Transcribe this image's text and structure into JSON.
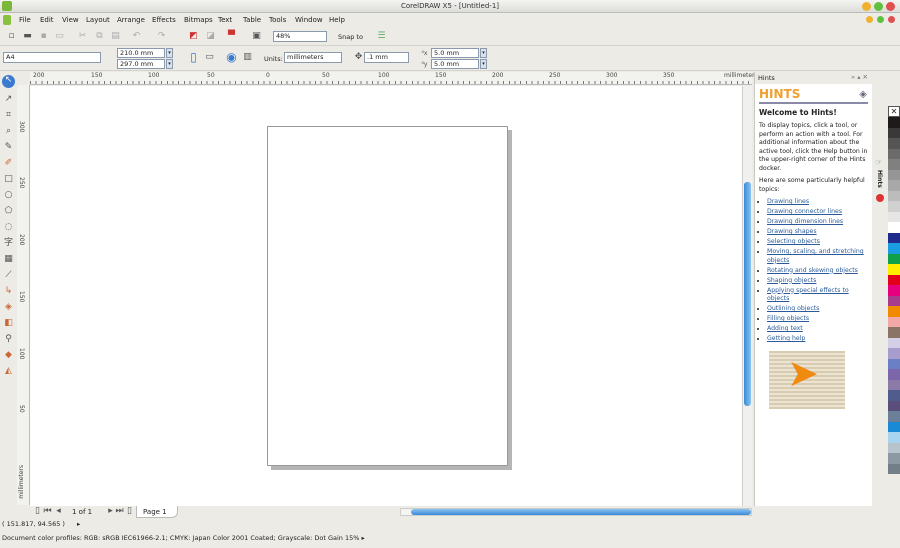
{
  "window": {
    "title": "CorelDRAW X5 - [Untitled-1]"
  },
  "menu": [
    "File",
    "Edit",
    "View",
    "Layout",
    "Arrange",
    "Effects",
    "Bitmaps",
    "Text",
    "Table",
    "Tools",
    "Window",
    "Help"
  ],
  "toolbar": {
    "zoom": "48%",
    "snap_to": "Snap to"
  },
  "propertybar": {
    "page_size": "A4",
    "width": "210.0 mm",
    "height": "297.0 mm",
    "units_label": "Units:",
    "units": "millimeters",
    "nudge": ".1 mm",
    "dup_x": "5.0 mm",
    "dup_y": "5.0 mm"
  },
  "ruler": {
    "top_ticks": [
      "200",
      "150",
      "100",
      "50",
      "0",
      "50",
      "100",
      "150",
      "200",
      "250",
      "300",
      "350"
    ],
    "unit": "millimeters",
    "left_ticks": [
      "300",
      "250",
      "200",
      "150",
      "100",
      "50"
    ]
  },
  "docker": {
    "tab": "Hints",
    "heading": "HINTS",
    "welcome": "Welcome to Hints!",
    "intro": "To display topics, click a tool, or perform an action with a tool. For additional information about the active tool, click the Help button in the upper-right corner of the Hints docker.",
    "topics_intro": "Here are some particularly helpful topics:",
    "topics": [
      "Drawing lines",
      "Drawing connector lines",
      "Drawing dimension lines",
      "Drawing shapes",
      "Selecting objects",
      "Moving, scaling, and stretching objects",
      "Rotating and skewing objects",
      "Shaping objects",
      "Applying special effects to objects",
      "Outlining objects",
      "Filling objects",
      "Adding text",
      "Getting help"
    ],
    "side_tab": "Hints"
  },
  "palette": [
    "#1e1a1a",
    "#3a3838",
    "#555555",
    "#6b6b6b",
    "#808080",
    "#959595",
    "#a8a8a8",
    "#bcbcbc",
    "#d0d0d0",
    "#e6e6e6",
    "#ffffff",
    "#1f2c8c",
    "#1a9ee0",
    "#10a04a",
    "#ffee00",
    "#e3001b",
    "#e6007e",
    "#a83c8c",
    "#f28a00",
    "#f4a9a9",
    "#8a7466",
    "#d3cfe6",
    "#a89ccc",
    "#6b7fc4",
    "#7a66a8",
    "#8c7aa8",
    "#4f5c8c",
    "#5a4f7a",
    "#6b7f99",
    "#1a8ad4",
    "#a8d4f0",
    "#b8c4cc",
    "#8c99a3",
    "#737f87"
  ],
  "pagenav": {
    "count": "1 of 1",
    "tab": "Page 1"
  },
  "status": {
    "coords": "( 151.817, 94.565 )",
    "profiles": "Document color profiles: RGB: sRGB IEC61966-2.1; CMYK: Japan Color 2001 Coated; Grayscale: Dot Gain 15%"
  }
}
